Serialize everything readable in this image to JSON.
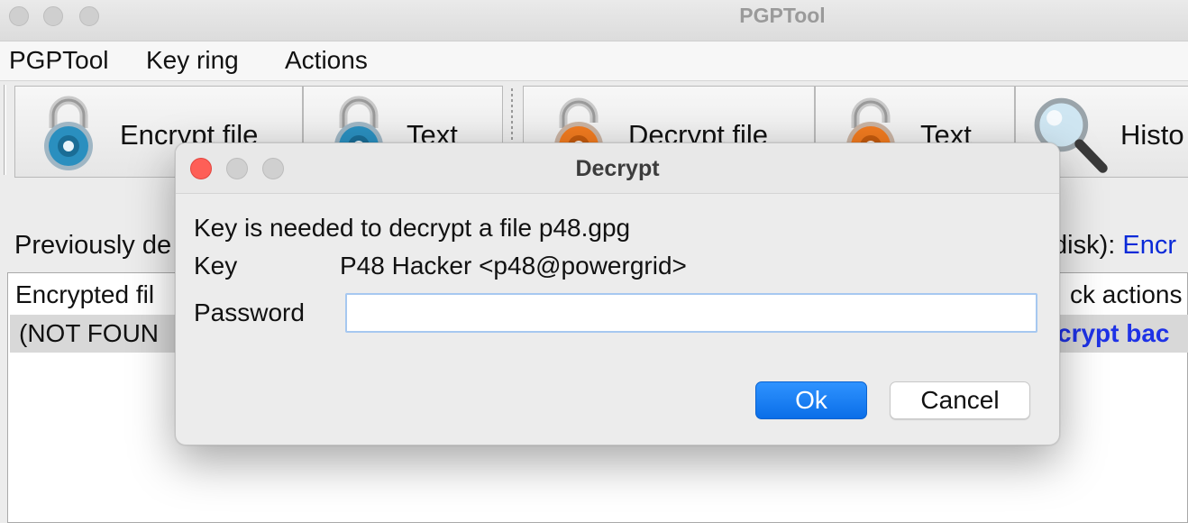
{
  "window": {
    "title": "PGPTool"
  },
  "menu": {
    "items": [
      "PGPTool",
      "Key ring",
      "Actions"
    ]
  },
  "toolbar": {
    "buttons": [
      {
        "label": "Encrypt file",
        "icon": "lock-closed-blue-icon"
      },
      {
        "label": "Text",
        "icon": "lock-closed-blue-icon"
      },
      {
        "label": "Decrypt file",
        "icon": "lock-open-orange-icon"
      },
      {
        "label": "Text",
        "icon": "lock-open-orange-icon"
      },
      {
        "label": "Histo",
        "icon": "magnifier-icon"
      }
    ]
  },
  "background": {
    "prev_label": "Previously de",
    "right_label_prefix": "disk):",
    "right_label_link": "Encr",
    "table": {
      "col_left": "Encrypted fil",
      "col_right": "ck actions",
      "row_left": "(NOT FOUN",
      "row_right": "crypt bac"
    }
  },
  "dialog": {
    "title": "Decrypt",
    "message": "Key is needed to decrypt a file p48.gpg",
    "key_label": "Key",
    "key_value": "P48 Hacker <p48@powergrid>",
    "password_label": "Password",
    "password_value": "",
    "ok_label": "Ok",
    "cancel_label": "Cancel"
  },
  "colors": {
    "accent": "#0a6ee8",
    "close": "#fe5f57",
    "link": "#1e32e6"
  }
}
